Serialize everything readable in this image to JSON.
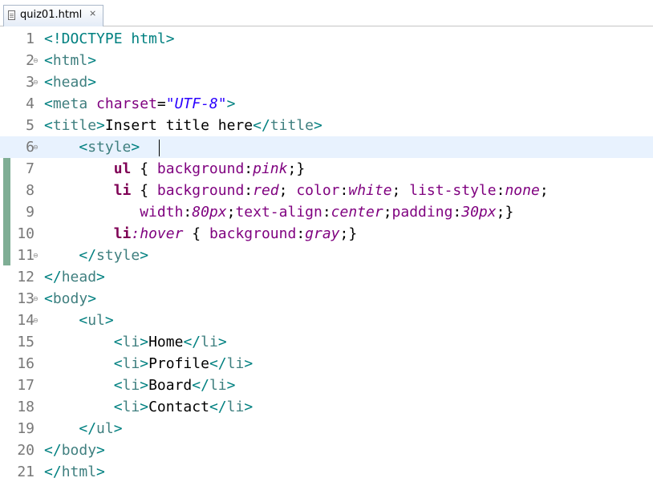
{
  "tab": {
    "title": "quiz01.html",
    "icon": "html-file-icon",
    "close_icon": "close-icon"
  },
  "colors": {
    "tag_delim": "#008080",
    "tag_name": "#3f7f7f",
    "attribute": "#7f007f",
    "string": "#2a00ff",
    "selector": "#7f0055",
    "css_value": "#7f007f",
    "current_line": "#e8f2fe",
    "change_bar": "#7fae95"
  },
  "editor": {
    "current_line": 6,
    "lines": [
      {
        "num": "1",
        "fold": false,
        "tokens": [
          {
            "t": "<!DOCTYPE html>",
            "k": 0
          }
        ]
      },
      {
        "num": "2",
        "fold": true,
        "tokens": [
          {
            "t": "<",
            "k": 0
          },
          {
            "t": "html",
            "k": 1
          },
          {
            "t": ">",
            "k": 0
          }
        ]
      },
      {
        "num": "3",
        "fold": true,
        "tokens": [
          {
            "t": "<",
            "k": 0
          },
          {
            "t": "head",
            "k": 1
          },
          {
            "t": ">",
            "k": 0
          }
        ]
      },
      {
        "num": "4",
        "fold": false,
        "tokens": [
          {
            "t": "<",
            "k": 0
          },
          {
            "t": "meta",
            "k": 1
          },
          {
            "t": " ",
            "k": 3
          },
          {
            "t": "charset",
            "k": 2
          },
          {
            "t": "=",
            "k": 3
          },
          {
            "t": "\"UTF-8\"",
            "k": 4
          },
          {
            "t": ">",
            "k": 0
          }
        ]
      },
      {
        "num": "5",
        "fold": false,
        "tokens": [
          {
            "t": "<",
            "k": 0
          },
          {
            "t": "title",
            "k": 1
          },
          {
            "t": ">",
            "k": 0
          },
          {
            "t": "Insert title here",
            "k": 3
          },
          {
            "t": "</",
            "k": 0
          },
          {
            "t": "title",
            "k": 1
          },
          {
            "t": ">",
            "k": 0
          }
        ]
      },
      {
        "num": "6",
        "fold": true,
        "tokens": [
          {
            "t": "    ",
            "k": 3
          },
          {
            "t": "<",
            "k": 0
          },
          {
            "t": "style",
            "k": 1
          },
          {
            "t": ">",
            "k": 0
          }
        ]
      },
      {
        "num": "7",
        "fold": false,
        "tokens": [
          {
            "t": "        ",
            "k": 3
          },
          {
            "t": "ul",
            "k": 5
          },
          {
            "t": " { ",
            "k": 3
          },
          {
            "t": "background",
            "k": 2
          },
          {
            "t": ":",
            "k": 3
          },
          {
            "t": "pink",
            "k": 6
          },
          {
            "t": ";}",
            "k": 3
          }
        ]
      },
      {
        "num": "8",
        "fold": false,
        "tokens": [
          {
            "t": "        ",
            "k": 3
          },
          {
            "t": "li",
            "k": 5
          },
          {
            "t": " { ",
            "k": 3
          },
          {
            "t": "background",
            "k": 2
          },
          {
            "t": ":",
            "k": 3
          },
          {
            "t": "red",
            "k": 6
          },
          {
            "t": "; ",
            "k": 3
          },
          {
            "t": "color",
            "k": 2
          },
          {
            "t": ":",
            "k": 3
          },
          {
            "t": "white",
            "k": 6
          },
          {
            "t": "; ",
            "k": 3
          },
          {
            "t": "list-style",
            "k": 2
          },
          {
            "t": ":",
            "k": 3
          },
          {
            "t": "none",
            "k": 6
          },
          {
            "t": ";",
            "k": 3
          }
        ]
      },
      {
        "num": "9",
        "fold": false,
        "tokens": [
          {
            "t": "           ",
            "k": 3
          },
          {
            "t": "width",
            "k": 2
          },
          {
            "t": ":",
            "k": 3
          },
          {
            "t": "80px",
            "k": 6
          },
          {
            "t": ";",
            "k": 3
          },
          {
            "t": "text-align",
            "k": 2
          },
          {
            "t": ":",
            "k": 3
          },
          {
            "t": "center",
            "k": 6
          },
          {
            "t": ";",
            "k": 3
          },
          {
            "t": "padding",
            "k": 2
          },
          {
            "t": ":",
            "k": 3
          },
          {
            "t": "30px",
            "k": 6
          },
          {
            "t": ";}",
            "k": 3
          }
        ]
      },
      {
        "num": "10",
        "fold": false,
        "tokens": [
          {
            "t": "        ",
            "k": 3
          },
          {
            "t": "li",
            "k": 5
          },
          {
            "t": ":hover",
            "k": 6
          },
          {
            "t": " { ",
            "k": 3
          },
          {
            "t": "background",
            "k": 2
          },
          {
            "t": ":",
            "k": 3
          },
          {
            "t": "gray",
            "k": 6
          },
          {
            "t": ";}",
            "k": 3
          }
        ]
      },
      {
        "num": "11",
        "fold": true,
        "tokens": [
          {
            "t": "    ",
            "k": 3
          },
          {
            "t": "</",
            "k": 0
          },
          {
            "t": "style",
            "k": 1
          },
          {
            "t": ">",
            "k": 0
          }
        ]
      },
      {
        "num": "12",
        "fold": false,
        "tokens": [
          {
            "t": "</",
            "k": 0
          },
          {
            "t": "head",
            "k": 1
          },
          {
            "t": ">",
            "k": 0
          }
        ]
      },
      {
        "num": "13",
        "fold": true,
        "tokens": [
          {
            "t": "<",
            "k": 0
          },
          {
            "t": "body",
            "k": 1
          },
          {
            "t": ">",
            "k": 0
          }
        ]
      },
      {
        "num": "14",
        "fold": true,
        "tokens": [
          {
            "t": "    ",
            "k": 3
          },
          {
            "t": "<",
            "k": 0
          },
          {
            "t": "ul",
            "k": 1
          },
          {
            "t": ">",
            "k": 0
          }
        ]
      },
      {
        "num": "15",
        "fold": false,
        "tokens": [
          {
            "t": "        ",
            "k": 3
          },
          {
            "t": "<",
            "k": 0
          },
          {
            "t": "li",
            "k": 1
          },
          {
            "t": ">",
            "k": 0
          },
          {
            "t": "Home",
            "k": 3
          },
          {
            "t": "</",
            "k": 0
          },
          {
            "t": "li",
            "k": 1
          },
          {
            "t": ">",
            "k": 0
          }
        ]
      },
      {
        "num": "16",
        "fold": false,
        "tokens": [
          {
            "t": "        ",
            "k": 3
          },
          {
            "t": "<",
            "k": 0
          },
          {
            "t": "li",
            "k": 1
          },
          {
            "t": ">",
            "k": 0
          },
          {
            "t": "Profile",
            "k": 3
          },
          {
            "t": "</",
            "k": 0
          },
          {
            "t": "li",
            "k": 1
          },
          {
            "t": ">",
            "k": 0
          }
        ]
      },
      {
        "num": "17",
        "fold": false,
        "tokens": [
          {
            "t": "        ",
            "k": 3
          },
          {
            "t": "<",
            "k": 0
          },
          {
            "t": "li",
            "k": 1
          },
          {
            "t": ">",
            "k": 0
          },
          {
            "t": "Board",
            "k": 3
          },
          {
            "t": "</",
            "k": 0
          },
          {
            "t": "li",
            "k": 1
          },
          {
            "t": ">",
            "k": 0
          }
        ]
      },
      {
        "num": "18",
        "fold": false,
        "tokens": [
          {
            "t": "        ",
            "k": 3
          },
          {
            "t": "<",
            "k": 0
          },
          {
            "t": "li",
            "k": 1
          },
          {
            "t": ">",
            "k": 0
          },
          {
            "t": "Contact",
            "k": 3
          },
          {
            "t": "</",
            "k": 0
          },
          {
            "t": "li",
            "k": 1
          },
          {
            "t": ">",
            "k": 0
          }
        ]
      },
      {
        "num": "19",
        "fold": false,
        "tokens": [
          {
            "t": "    ",
            "k": 3
          },
          {
            "t": "</",
            "k": 0
          },
          {
            "t": "ul",
            "k": 1
          },
          {
            "t": ">",
            "k": 0
          }
        ]
      },
      {
        "num": "20",
        "fold": false,
        "tokens": [
          {
            "t": "</",
            "k": 0
          },
          {
            "t": "body",
            "k": 1
          },
          {
            "t": ">",
            "k": 0
          }
        ]
      },
      {
        "num": "21",
        "fold": false,
        "tokens": [
          {
            "t": "</",
            "k": 0
          },
          {
            "t": "html",
            "k": 1
          },
          {
            "t": ">",
            "k": 0
          }
        ]
      }
    ]
  }
}
